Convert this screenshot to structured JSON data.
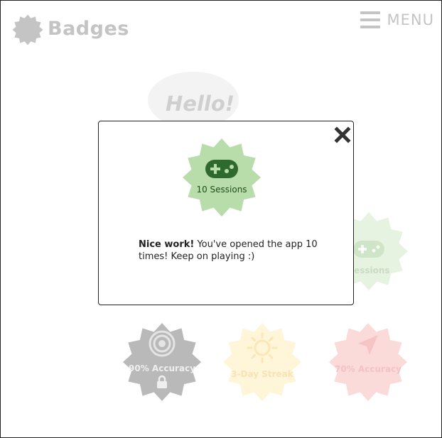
{
  "header": {
    "title": "Badges",
    "menu_label": "MENU"
  },
  "hello": {
    "text": "Hello!"
  },
  "background_badges": [
    {
      "label": "Sessions",
      "color": "#e6f3e1"
    },
    {
      "label": "90% Accuracy",
      "color": "#b9b9b9"
    },
    {
      "label": "3-Day Streak",
      "color": "#fff5d9"
    },
    {
      "label": "70% Accuracy",
      "color": "#fbdada"
    }
  ],
  "modal": {
    "badge_label": "10 Sessions",
    "badge_color": "#b8dcaa",
    "message_bold": "Nice work!",
    "message_rest": " You've opened the app 10 times! Keep on playing :)"
  },
  "colors": {
    "muted_text": "#c4c4c4",
    "green_icon": "#2e6a2e"
  }
}
